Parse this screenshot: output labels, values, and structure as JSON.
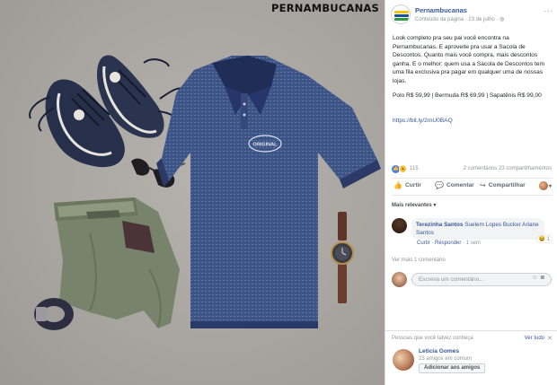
{
  "photo": {
    "watermark": "PERNAMBUCANAS",
    "shirt_logo": "ORIGINAL"
  },
  "post": {
    "page_name": "Pernambucanas",
    "meta": "Conteúdo da página · 23 de julho ·",
    "text": "Look completo pra seu pai você encontra na Pernambucanas. E aproveite pra usar a Sacola de Descontos. Quanto mais você compra, mais descontos ganha. E o melhor: quem usa a Sacola de Descontos tem uma fila exclusiva pra pagar em qualquer uma de nossas lojas.",
    "prices": "Polo R$ 59,99 | Bermuda R$ 69,99 | Sapatênis R$ 99,00",
    "link": "https://bit.ly/2mU0BAQ"
  },
  "stats": {
    "reactions_count": "115",
    "comments_shares": "2 comentários  23 compartilhamentos"
  },
  "actions": {
    "like": "Curtir",
    "comment": "Comentar",
    "share": "Compartilhar"
  },
  "comments": {
    "filter_label": "Mais relevantes ▾",
    "first": {
      "author": "Terezinha Santos",
      "text": "Suelem Lopes Bucker Ariane Santos",
      "actions": "Curtir · Responder · ",
      "time": "1 sem",
      "reaction_count": "1"
    },
    "more_label": "Ver mais 1 comentário",
    "write_placeholder": "Escreva um comentário..."
  },
  "suggestions": {
    "heading": "Pessoas que você talvez conheça",
    "see_all": "Ver tudo",
    "person_name": "Leticia Gomes",
    "mutual": "23 amigos em comum",
    "add_label": "Adicionar aos amigos"
  },
  "colors": {
    "link_blue": "#385898",
    "like_blue": "#4a7cf6",
    "muted": "#90949c",
    "shirt_blue": "#3e5588",
    "collar_navy": "#1f2d57"
  },
  "icons": [
    "menu-dots-icon",
    "like-icon",
    "comment-icon",
    "share-icon",
    "emoji-icon",
    "camera-icon",
    "close-icon"
  ]
}
